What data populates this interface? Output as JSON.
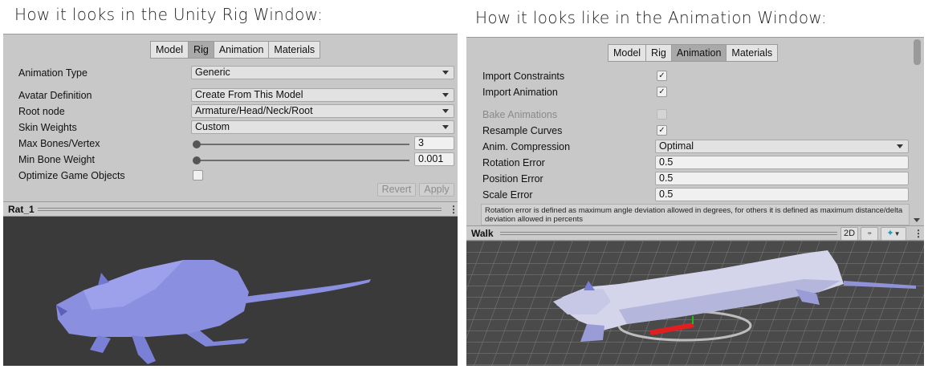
{
  "captions": {
    "left": "How it looks in the Unity Rig Window:",
    "right": "How it looks like in the Animation Window:"
  },
  "rig_window": {
    "tabs": [
      "Model",
      "Rig",
      "Animation",
      "Materials"
    ],
    "active_tab": "Rig",
    "fields": {
      "animation_type": {
        "label": "Animation Type",
        "value": "Generic"
      },
      "avatar_definition": {
        "label": "Avatar Definition",
        "value": "Create From This Model"
      },
      "root_node": {
        "label": "Root node",
        "value": "Armature/Head/Neck/Root"
      },
      "skin_weights": {
        "label": "Skin Weights",
        "value": "Custom"
      },
      "max_bones": {
        "label": "Max Bones/Vertex",
        "value": "3"
      },
      "min_bone_weight": {
        "label": "Min Bone Weight",
        "value": "0.001"
      },
      "optimize": {
        "label": "Optimize Game Objects",
        "checked": false
      }
    },
    "buttons": {
      "revert": "Revert",
      "apply": "Apply"
    },
    "preview": {
      "title": "Rat_1",
      "menu_icon": "⋮"
    }
  },
  "animation_window": {
    "tabs": [
      "Model",
      "Rig",
      "Animation",
      "Materials"
    ],
    "active_tab": "Animation",
    "fields": {
      "import_constraints": {
        "label": "Import Constraints",
        "checked": true
      },
      "import_animation": {
        "label": "Import Animation",
        "checked": true
      },
      "bake_animations": {
        "label": "Bake Animations",
        "checked": false,
        "disabled": true
      },
      "resample_curves": {
        "label": "Resample Curves",
        "checked": true
      },
      "anim_compression": {
        "label": "Anim. Compression",
        "value": "Optimal"
      },
      "rotation_error": {
        "label": "Rotation Error",
        "value": "0.5"
      },
      "position_error": {
        "label": "Position Error",
        "value": "0.5"
      },
      "scale_error": {
        "label": "Scale Error",
        "value": "0.5"
      }
    },
    "info_text": "Rotation error is defined as maximum angle deviation allowed in degrees, for others it is defined as maximum distance/delta deviation allowed in percents",
    "preview": {
      "title": "Walk",
      "btn_2d": "2D",
      "pivot_icon": "⍆",
      "avatar_icon": "✦",
      "menu_icon": "⋮"
    }
  },
  "colors": {
    "panel_bg": "#c8c8c8",
    "active_tab": "#a9a9a9",
    "viewport_left": "#3a3a3a",
    "viewport_right": "#4a4a4a",
    "rat": "#8b8fe0"
  }
}
